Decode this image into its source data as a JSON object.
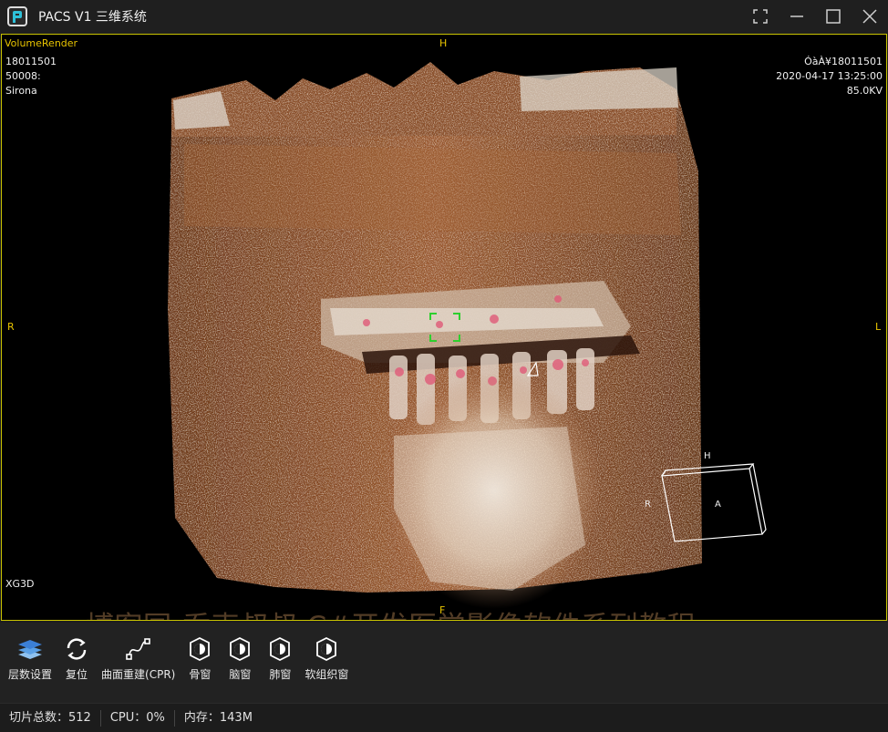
{
  "window": {
    "title": "PACS V1 三维系统",
    "logo_icon": "pacs-logo"
  },
  "viewport": {
    "mode": "VolumeRender",
    "top_left": [
      "18011501",
      "50008:",
      "Sirona"
    ],
    "top_right": [
      "ÓàÀ¥18011501",
      "2020-04-17 13:25:00",
      "85.0KV"
    ],
    "bottom_left": "XG3D",
    "orient": {
      "top": "H",
      "bottom": "F",
      "left": "R",
      "right": "L"
    },
    "cube": {
      "top": "H",
      "left": "R",
      "front": "A"
    },
    "watermark": "博客园-乔克叔叔 C#开发医学影像软件系列教程",
    "border_color": "#c9c300"
  },
  "toolbar": [
    {
      "label": "层数设置",
      "icon": "layers-icon"
    },
    {
      "label": "复位",
      "icon": "reset-icon"
    },
    {
      "label": "曲面重建(CPR)",
      "icon": "curve-icon"
    },
    {
      "label": "骨窗",
      "icon": "bone-window-icon"
    },
    {
      "label": "脑窗",
      "icon": "brain-window-icon"
    },
    {
      "label": "肺窗",
      "icon": "lung-window-icon"
    },
    {
      "label": "软组织窗",
      "icon": "soft-tissue-window-icon"
    }
  ],
  "status": {
    "slices": "切片总数：512",
    "cpu": "CPU：0%",
    "memory": "内存：143M"
  }
}
